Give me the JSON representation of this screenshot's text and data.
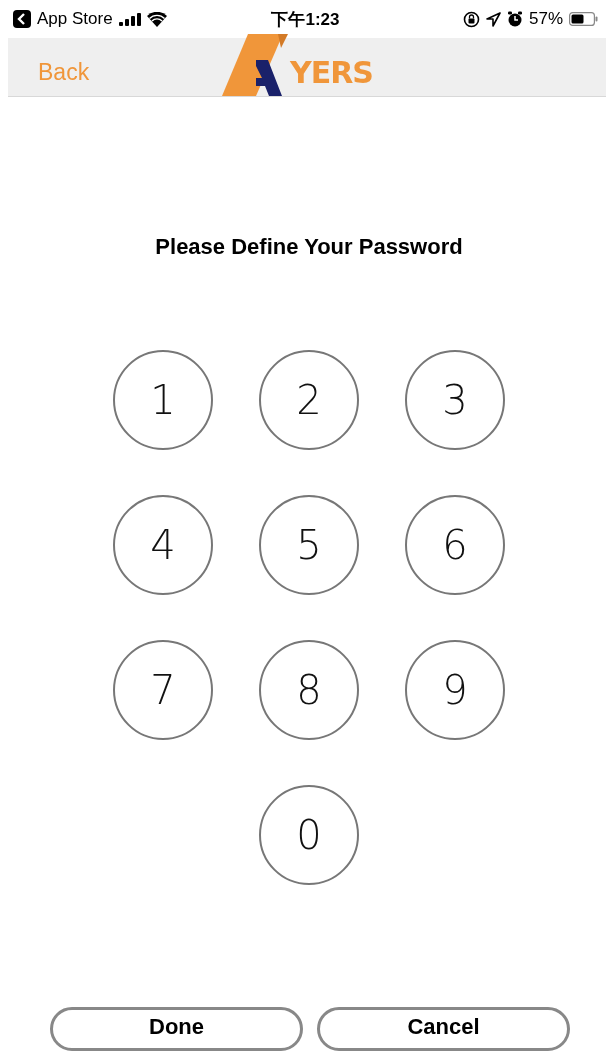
{
  "status_bar": {
    "back_app": "App Store",
    "time": "下午1:23",
    "battery": "57%"
  },
  "nav_bar": {
    "back": "Back",
    "logo_text": "YERS"
  },
  "title": "Please Define Your Password",
  "keys": [
    "1",
    "2",
    "3",
    "4",
    "5",
    "6",
    "7",
    "8",
    "9",
    "0"
  ],
  "buttons": [
    {
      "label": "Done"
    },
    {
      "label": "Cancel"
    }
  ]
}
